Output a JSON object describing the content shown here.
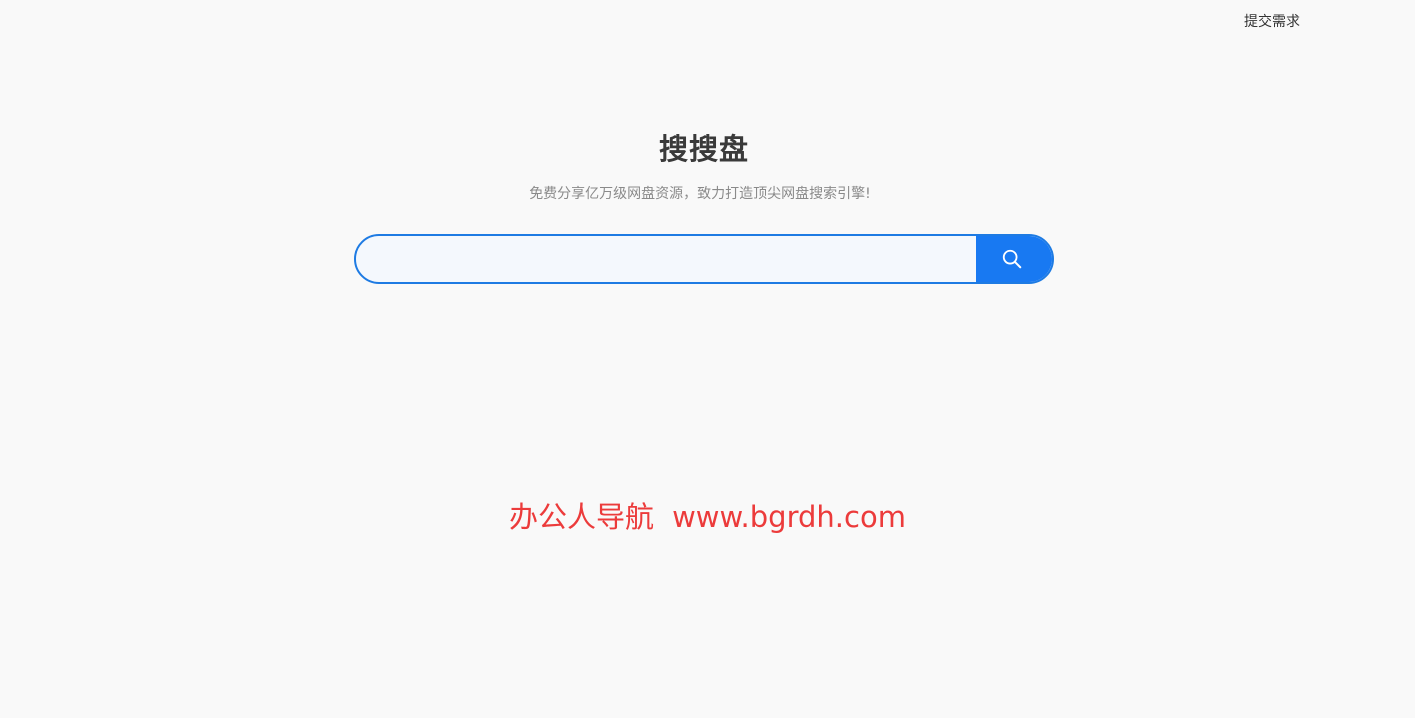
{
  "header": {
    "submit_request_label": "提交需求"
  },
  "hero": {
    "title": "搜搜盘",
    "subtitle": "免费分享亿万级网盘资源，致力打造顶尖网盘搜索引擎!"
  },
  "search": {
    "value": "",
    "placeholder": "",
    "button_icon": "search-icon"
  },
  "watermark": {
    "name": "办公人导航",
    "url": "www.bgrdh.com"
  },
  "colors": {
    "background": "#f9f9f9",
    "accent": "#1879f2",
    "watermark": "#ec3b3b"
  }
}
